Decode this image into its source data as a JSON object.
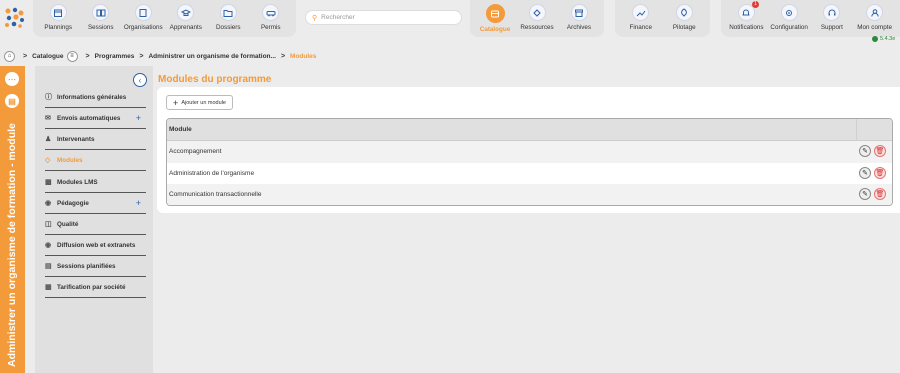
{
  "nav_group1": [
    {
      "label": "Plannings",
      "icon": "calendar-icon"
    },
    {
      "label": "Sessions",
      "icon": "book-icon"
    },
    {
      "label": "Organisations",
      "icon": "building-icon"
    },
    {
      "label": "Apprenants",
      "icon": "graduation-cap-icon"
    },
    {
      "label": "Dossiers",
      "icon": "folder-icon"
    },
    {
      "label": "Permis",
      "icon": "car-icon"
    }
  ],
  "search": {
    "placeholder": "Rechercher"
  },
  "nav_group2": [
    {
      "label": "Catalogue",
      "icon": "catalogue-icon",
      "active": true
    },
    {
      "label": "Ressources",
      "icon": "resources-icon"
    },
    {
      "label": "Archives",
      "icon": "archive-icon"
    }
  ],
  "nav_group3": [
    {
      "label": "Finance",
      "icon": "chart-icon"
    },
    {
      "label": "Pilotage",
      "icon": "rocket-icon"
    }
  ],
  "nav_group4": [
    {
      "label": "Notifications",
      "icon": "bell-icon",
      "badge": "1"
    },
    {
      "label": "Configuration",
      "icon": "gear-icon"
    },
    {
      "label": "Support",
      "icon": "headset-icon"
    },
    {
      "label": "Mon compte",
      "icon": "user-icon"
    }
  ],
  "version": "5.4.3e",
  "breadcrumb": {
    "catalogue": "Catalogue",
    "programmes": "Programmes",
    "organisme": "Administrer un organisme de formation...",
    "current": "Modules"
  },
  "vertical_title": "Administrer un organisme de formation - module",
  "sidebar": {
    "items": [
      {
        "label": "Informations générales",
        "icon": "info-icon"
      },
      {
        "label": "Envois automatiques",
        "icon": "mail-icon",
        "plus": "+"
      },
      {
        "label": "Intervenants",
        "icon": "users-icon"
      },
      {
        "label": "Modules",
        "icon": "modules-icon",
        "active": true
      },
      {
        "label": "Modules LMS",
        "icon": "lms-icon"
      },
      {
        "label": "Pédagogie",
        "icon": "pedagogy-icon",
        "plus": "+"
      },
      {
        "label": "Qualité",
        "icon": "quality-icon"
      },
      {
        "label": "Diffusion web et extranets",
        "icon": "broadcast-icon"
      },
      {
        "label": "Sessions planifiées",
        "icon": "sessions-icon"
      },
      {
        "label": "Tarification par société",
        "icon": "pricing-icon"
      }
    ]
  },
  "main": {
    "title": "Modules du programme",
    "add_button": "Ajouter un module",
    "column_header": "Module",
    "rows": [
      "Accompagnement",
      "Administration de l'organisme",
      "Communication transactionnelle"
    ]
  },
  "colors": {
    "accent": "#f39a3a",
    "primary": "#2d62a6"
  }
}
